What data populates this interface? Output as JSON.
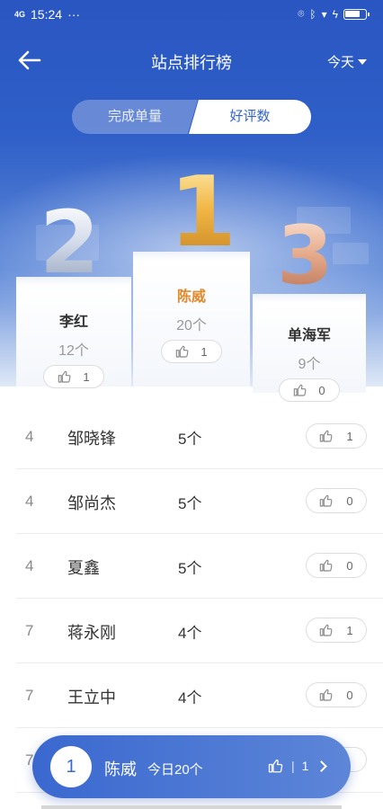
{
  "status_bar": {
    "network": "4G",
    "time": "15:24",
    "more": "···"
  },
  "nav": {
    "title": "站点排行榜",
    "date_filter": "今天"
  },
  "tabs": [
    {
      "label": "完成单量",
      "active": false
    },
    {
      "label": "好评数",
      "active": true
    }
  ],
  "podium": {
    "first": {
      "place": "1",
      "name": "陈威",
      "count": "20个",
      "likes": "1"
    },
    "second": {
      "place": "2",
      "name": "李红",
      "count": "12个",
      "likes": "1"
    },
    "third": {
      "place": "3",
      "name": "单海军",
      "count": "9个",
      "likes": "0"
    }
  },
  "rankings": [
    {
      "rank": "4",
      "name": "邹晓锋",
      "count": "5个",
      "likes": "1"
    },
    {
      "rank": "4",
      "name": "邹尚杰",
      "count": "5个",
      "likes": "0"
    },
    {
      "rank": "4",
      "name": "夏鑫",
      "count": "5个",
      "likes": "0"
    },
    {
      "rank": "7",
      "name": "蒋永刚",
      "count": "4个",
      "likes": "1"
    },
    {
      "rank": "7",
      "name": "王立中",
      "count": "4个",
      "likes": "0"
    },
    {
      "rank": "7",
      "name": "",
      "count": "",
      "likes": ""
    }
  ],
  "my_rank": {
    "rank": "1",
    "name": "陈威",
    "today": "今日20个",
    "likes": "1"
  },
  "colors": {
    "primary": "#3263c9",
    "gold": "#e08a2c"
  }
}
